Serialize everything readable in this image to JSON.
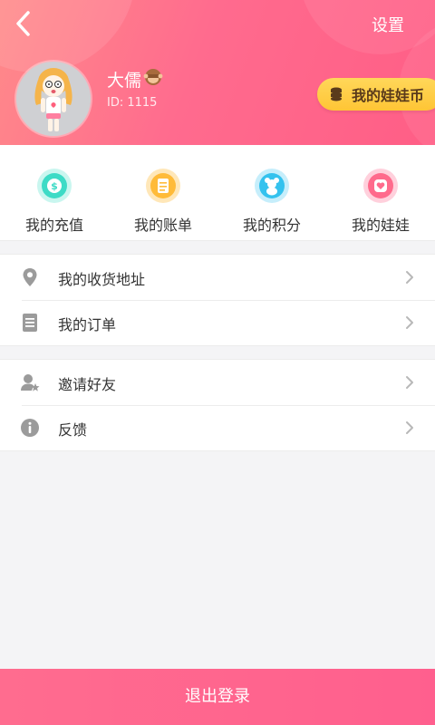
{
  "header": {
    "settings_label": "设置",
    "user": {
      "name": "大儒",
      "id_text": "ID: 1115"
    },
    "coin_button_label": "我的娃娃币",
    "colors": {
      "gradient_start": "#ff8a8a",
      "gradient_end": "#ff5e86",
      "coin_pill": "#ffc535"
    }
  },
  "quick_menu": [
    {
      "label": "我的充值",
      "icon": "dollar-icon",
      "color": "#3ddbc6"
    },
    {
      "label": "我的账单",
      "icon": "bill-icon",
      "color": "#ffbb39"
    },
    {
      "label": "我的积分",
      "icon": "bear-icon",
      "color": "#34c2ee"
    },
    {
      "label": "我的娃娃",
      "icon": "heart-doll-icon",
      "color": "#ff6a8c"
    }
  ],
  "list_section_1": [
    {
      "label": "我的收货地址",
      "icon": "location-pin-icon"
    },
    {
      "label": "我的订单",
      "icon": "order-list-icon"
    }
  ],
  "list_section_2": [
    {
      "label": "邀请好友",
      "icon": "invite-user-icon"
    },
    {
      "label": "反馈",
      "icon": "info-icon"
    }
  ],
  "logout_label": "退出登录"
}
